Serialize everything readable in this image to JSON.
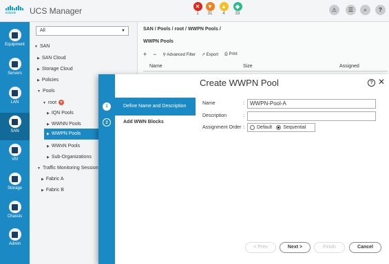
{
  "app": {
    "logo_text": "cisco",
    "title": "UCS Manager"
  },
  "faults": [
    {
      "icon": "critical-fault-icon",
      "symbol": "✕",
      "count": "1",
      "color": "#e2231a"
    },
    {
      "icon": "major-fault-icon",
      "symbol": "▼",
      "count": "31",
      "color": "#f07f1d"
    },
    {
      "icon": "minor-fault-icon",
      "symbol": "▲",
      "count": "4",
      "color": "#f5c01e"
    },
    {
      "icon": "warning-icon",
      "symbol": "◆",
      "count": "33",
      "color": "#2bbc8a"
    }
  ],
  "toolbar_icons": [
    "alert-icon",
    "options-icon",
    "search-icon",
    "help-icon"
  ],
  "nav": [
    {
      "label": "Equipment",
      "icon": "equipment-icon"
    },
    {
      "label": "Servers",
      "icon": "servers-icon"
    },
    {
      "label": "LAN",
      "icon": "lan-icon"
    },
    {
      "label": "SAN",
      "icon": "san-icon",
      "active": true
    },
    {
      "label": "VM",
      "icon": "vm-icon"
    },
    {
      "label": "Storage",
      "icon": "storage-icon"
    },
    {
      "label": "Chassis",
      "icon": "chassis-icon"
    },
    {
      "label": "Admin",
      "icon": "admin-icon"
    }
  ],
  "tree": {
    "filter": "All",
    "nodes": {
      "san": "SAN",
      "san_cloud": "SAN Cloud",
      "storage_cloud": "Storage Cloud",
      "policies": "Policies",
      "pools": "Pools",
      "root": "root",
      "iqn_pools": "IQN Pools",
      "wwnn_pools": "WWNN Pools",
      "wwpn_pools": "WWPN Pools",
      "wwxn_pools": "WWxN Pools",
      "sub_orgs": "Sub-Organizations",
      "traffic": "Traffic Monitoring Sessions",
      "fabric_a": "Fabric A",
      "fabric_b": "Fabric B"
    }
  },
  "main": {
    "breadcrumb": "SAN / Pools / root / WWPN Pools /",
    "section_title": "WWPN Pools",
    "toolbar": {
      "add": "+",
      "remove": "−",
      "advanced_filter": "Advanced Filter",
      "export": "Export",
      "print": "Print"
    },
    "columns": {
      "name": "Name",
      "size": "Size",
      "assigned": "Assigned"
    }
  },
  "dialog": {
    "title": "Create WWPN Pool",
    "steps": [
      {
        "num": "1",
        "label": "Define Name and Description"
      },
      {
        "num": "2",
        "label": "Add WWN Blocks"
      }
    ],
    "fields": {
      "name_label": "Name",
      "name_value": "WWPN-Pool-A",
      "description_label": "Description",
      "description_value": "",
      "assignment_label": "Assignment Order",
      "colon": ":",
      "option_default": "Default",
      "option_sequential": "Sequential"
    },
    "buttons": {
      "prev": "< Prev",
      "next": "Next >",
      "finish": "Finish",
      "cancel": "Cancel"
    }
  }
}
